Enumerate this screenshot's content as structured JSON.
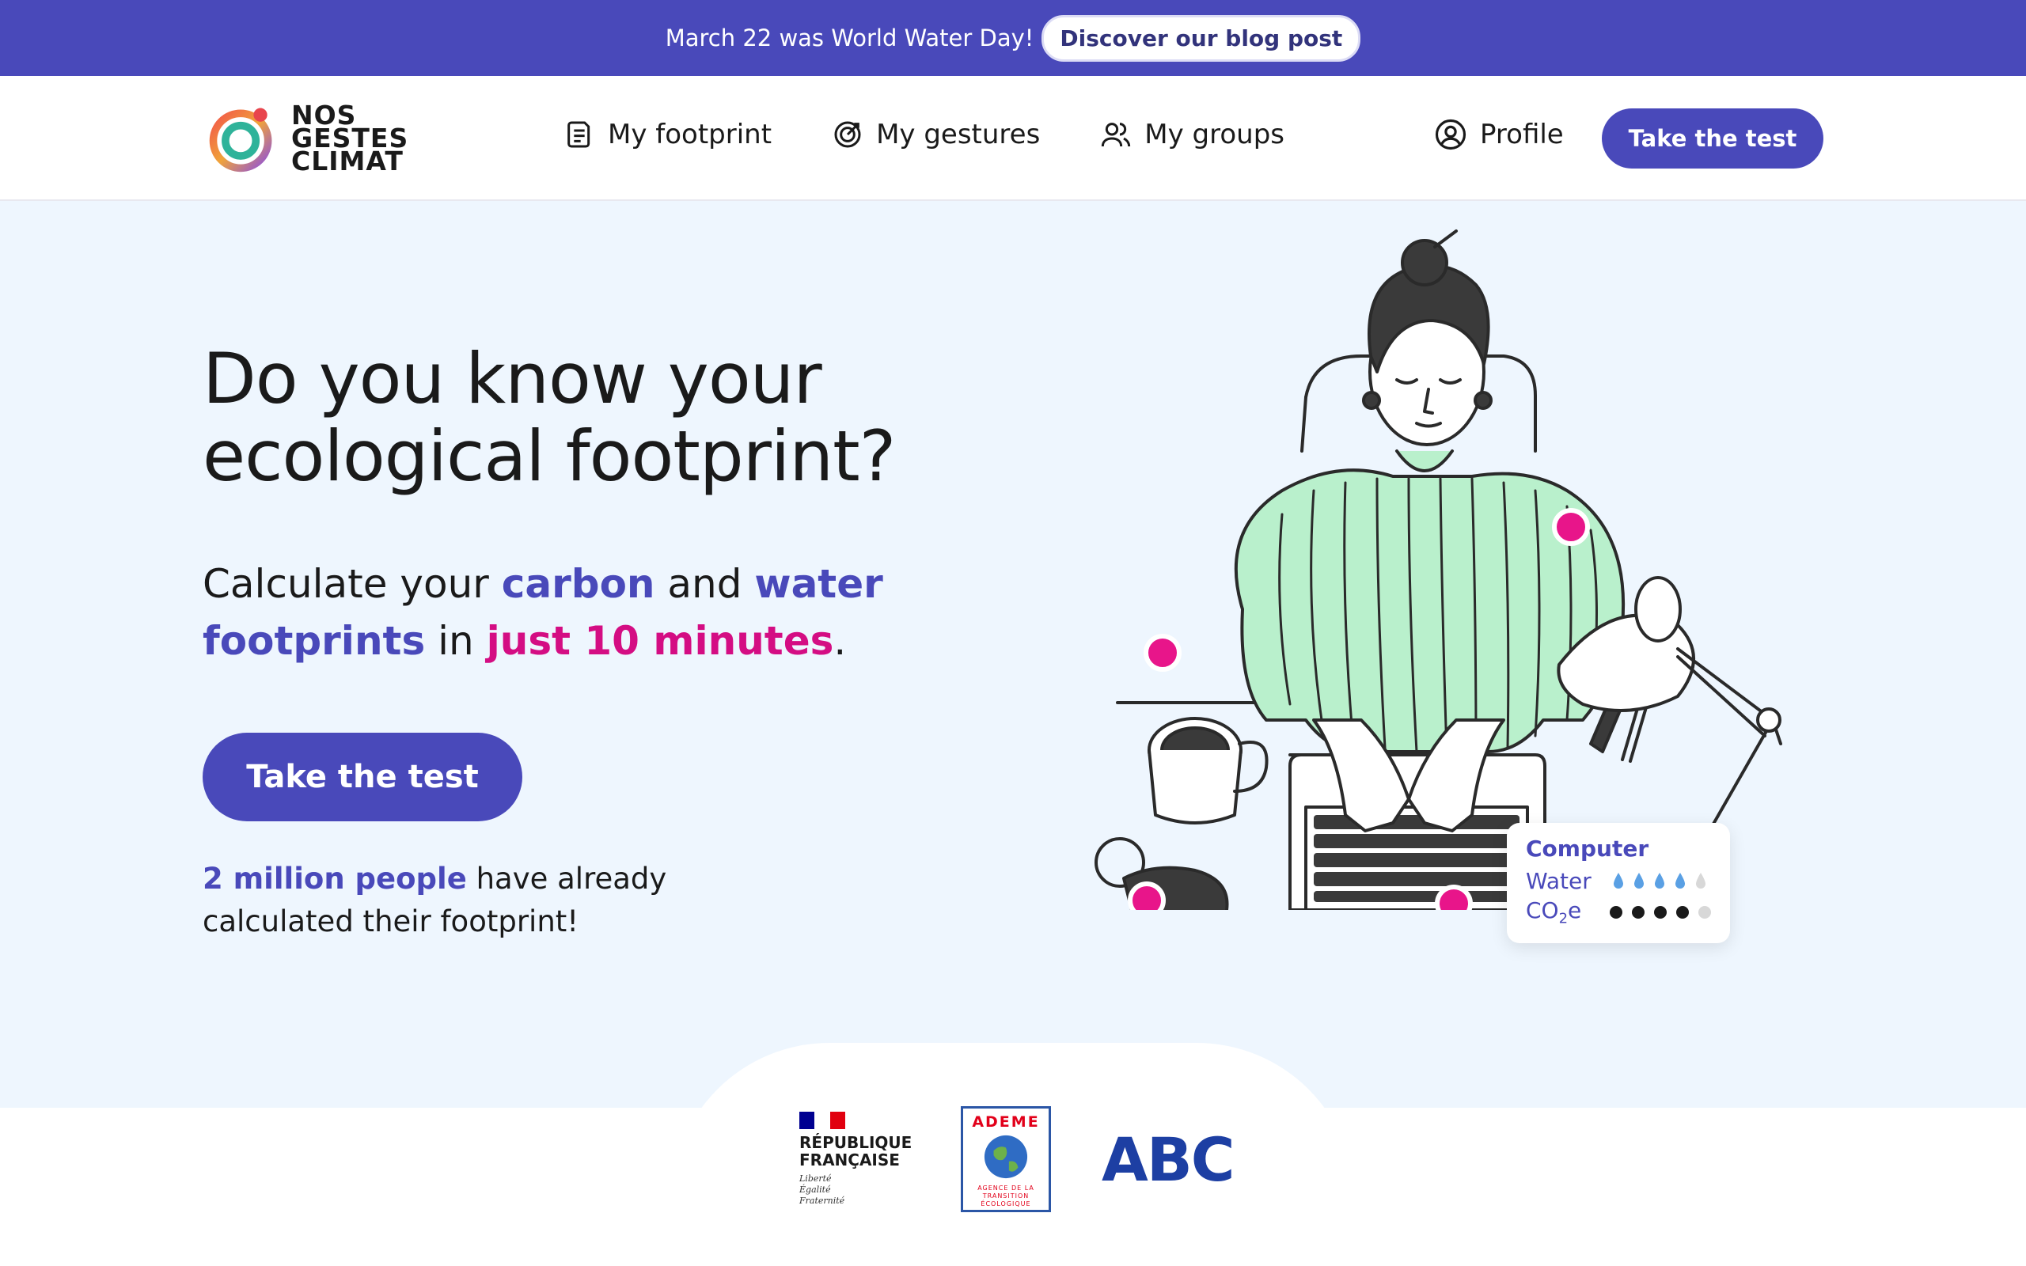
{
  "banner": {
    "text": "March 22 was World Water Day!",
    "link_label": "Discover our blog post"
  },
  "header": {
    "logo": [
      "NOS",
      "GESTES",
      "CLIMAT"
    ],
    "nav": [
      {
        "label": "My footprint",
        "icon": "document-icon"
      },
      {
        "label": "My gestures",
        "icon": "target-icon"
      },
      {
        "label": "My groups",
        "icon": "users-icon"
      }
    ],
    "profile_label": "Profile",
    "cta_label": "Take the test"
  },
  "hero": {
    "title": "Do you know your ecological footprint?",
    "subtitle": {
      "p1": "Calculate your ",
      "carbon": "carbon",
      "p2": " and ",
      "water_footprints": "water footprints",
      "p3": " in ",
      "duration": "just 10 minutes",
      "p4": "."
    },
    "cta_label": "Take the test",
    "count": {
      "highlight": "2 million people",
      "rest": " have already calculated their footprint!"
    }
  },
  "info_card": {
    "title": "Computer",
    "water_label": "Water",
    "water_level": 4,
    "co2_label_main": "CO",
    "co2_label_sub": "2",
    "co2_label_end": "e",
    "co2_level": 4,
    "max_level": 5
  },
  "partners": {
    "rf_name_1": "RÉPUBLIQUE",
    "rf_name_2": "FRANÇAISE",
    "rf_motto": [
      "Liberté",
      "Égalité",
      "Fraternité"
    ],
    "ademe_name": "ADEME",
    "ademe_sub": [
      "AGENCE DE LA",
      "TRANSITION",
      "ÉCOLOGIQUE"
    ],
    "abc": "ABC"
  },
  "colors": {
    "primary": "#4949ba",
    "accent_pink": "#d40d83",
    "hero_bg": "#eef6fe",
    "sweater": "#b9f0cc"
  }
}
